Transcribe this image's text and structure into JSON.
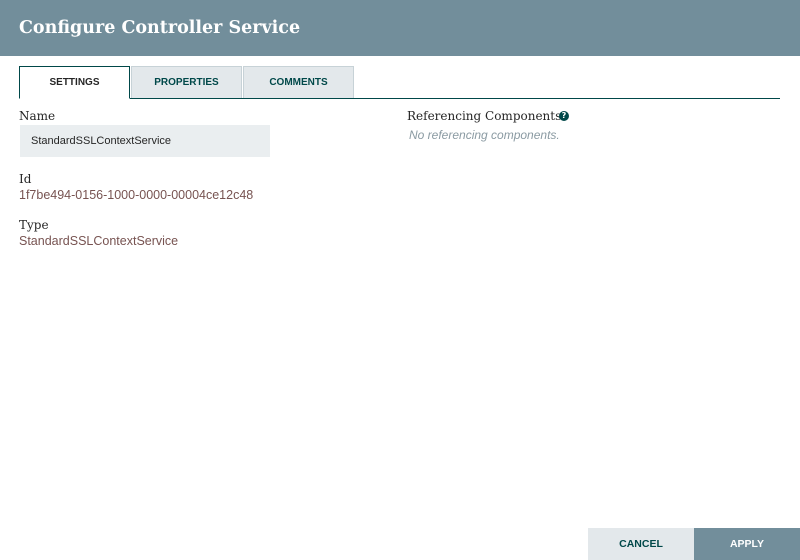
{
  "dialog": {
    "title": "Configure Controller Service"
  },
  "tabs": [
    {
      "label": "SETTINGS",
      "active": true
    },
    {
      "label": "PROPERTIES",
      "active": false
    },
    {
      "label": "COMMENTS",
      "active": false
    }
  ],
  "settings": {
    "name_label": "Name",
    "name_value": "StandardSSLContextService",
    "id_label": "Id",
    "id_value": "1f7be494-0156-1000-0000-00004ce12c48",
    "type_label": "Type",
    "type_value": "StandardSSLContextService"
  },
  "referencing": {
    "label": "Referencing Components",
    "help_icon": "question-circle-icon",
    "empty_text": "No referencing components."
  },
  "footer": {
    "cancel_label": "CANCEL",
    "apply_label": "APPLY"
  },
  "colors": {
    "header_bg": "#728e9b",
    "accent": "#004849",
    "link": "#775351",
    "input_bg": "#eaeef0"
  }
}
